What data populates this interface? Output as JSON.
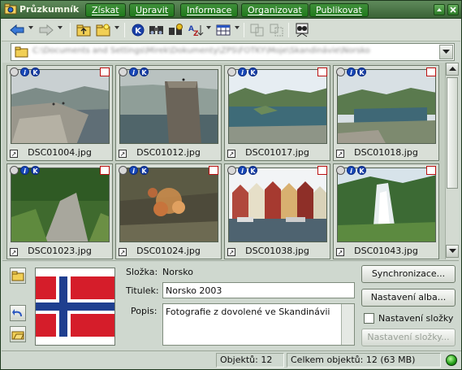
{
  "window": {
    "title": "Průzkumník",
    "menu": [
      "Získat",
      "Upravit",
      "Informace",
      "Organizovat",
      "Publikovat"
    ]
  },
  "toolbar": {
    "icons": [
      "back-arrow-icon",
      "forward-arrow-icon",
      "folder-up-icon",
      "new-folder-icon",
      "keywords-icon",
      "find-icon",
      "find-info-icon",
      "sort-az-icon",
      "view-grid-icon",
      "copy-to-icon",
      "move-to-icon",
      "slideshow-icon"
    ]
  },
  "address": {
    "path": "C:\\Documents and Settings\\Mirek\\Dokumenty\\ZPS\\FOTKY\\Moje\\Skandinávie\\Norsko"
  },
  "thumbnails": [
    {
      "filename": "DSC01004.jpg"
    },
    {
      "filename": "DSC01012.jpg"
    },
    {
      "filename": "DSC01017.jpg"
    },
    {
      "filename": "DSC01018.jpg"
    },
    {
      "filename": "DSC01023.jpg"
    },
    {
      "filename": "DSC01024.jpg"
    },
    {
      "filename": "DSC01038.jpg"
    },
    {
      "filename": "DSC01043.jpg"
    }
  ],
  "details": {
    "folder_label": "Složka:",
    "folder_value": "Norsko",
    "title_label": "Titulek:",
    "title_value": "Norsko 2003",
    "desc_label": "Popis:",
    "desc_value": "Fotografie z dovolené ve Skandinávii"
  },
  "buttons": {
    "sync": "Synchronizace...",
    "album_settings": "Nastavení alba...",
    "folder_settings_checkbox": "Nastavení složky",
    "folder_settings": "Nastavení složky..."
  },
  "status": {
    "objects": "Objektů: 12",
    "total": "Celkem objektů: 12 (63 MB)"
  },
  "colors": {
    "titlebar": "#3a6236",
    "menu_button": "#207a1c",
    "flag_red": "#d51d2a",
    "flag_blue": "#1f3f8f"
  }
}
